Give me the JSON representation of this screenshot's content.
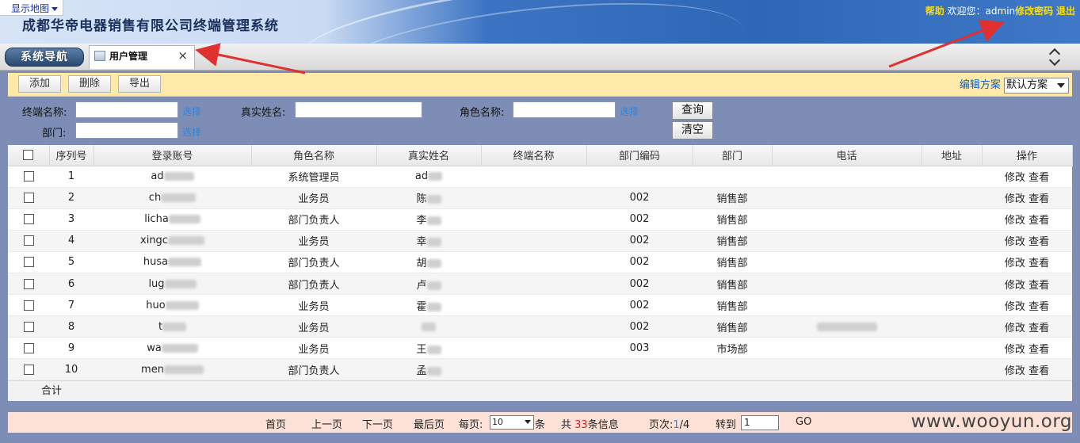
{
  "header": {
    "map_toggle": "显示地图",
    "system_title": "成都华帝电器销售有限公司终端管理系统",
    "help": "帮助",
    "welcome": "欢迎您：admin",
    "change_password": "修改密码",
    "logout": "退出"
  },
  "tabs": {
    "nav_button": "系统导航",
    "active_tab": "用户管理",
    "close_glyph": "×"
  },
  "toolbar": {
    "add": "添加",
    "delete": "删除",
    "export": "导出",
    "edit_plan": "编辑方案",
    "plan_value": "默认方案"
  },
  "filters": {
    "terminal_label": "终端名称:",
    "dept_label": "部门:",
    "real_name_label": "真实姓名:",
    "role_label": "角色名称:",
    "pick": "选择",
    "query": "查询",
    "clear": "清空"
  },
  "table": {
    "headers": [
      "序列号",
      "登录账号",
      "角色名称",
      "真实姓名",
      "终端名称",
      "部门编码",
      "部门",
      "电话",
      "地址",
      "操作"
    ],
    "rows": [
      {
        "seq": "1",
        "account": "ad",
        "role": "系统管理员",
        "name": "ad",
        "terminal": "",
        "dept_code": "",
        "dept": "",
        "phone": "",
        "address": ""
      },
      {
        "seq": "2",
        "account": "ch",
        "role": "业务员",
        "name": "陈",
        "terminal": "",
        "dept_code": "002",
        "dept": "销售部",
        "phone": "",
        "address": ""
      },
      {
        "seq": "3",
        "account": "licha",
        "role": "部门负责人",
        "name": "李",
        "terminal": "",
        "dept_code": "002",
        "dept": "销售部",
        "phone": "",
        "address": ""
      },
      {
        "seq": "4",
        "account": "xingc",
        "role": "业务员",
        "name": "幸",
        "terminal": "",
        "dept_code": "002",
        "dept": "销售部",
        "phone": "",
        "address": ""
      },
      {
        "seq": "5",
        "account": "husa",
        "role": "部门负责人",
        "name": "胡",
        "terminal": "",
        "dept_code": "002",
        "dept": "销售部",
        "phone": "",
        "address": ""
      },
      {
        "seq": "6",
        "account": "lug",
        "role": "部门负责人",
        "name": "卢",
        "terminal": "",
        "dept_code": "002",
        "dept": "销售部",
        "phone": "",
        "address": ""
      },
      {
        "seq": "7",
        "account": "huo",
        "role": "业务员",
        "name": "霍",
        "terminal": "",
        "dept_code": "002",
        "dept": "销售部",
        "phone": "",
        "address": ""
      },
      {
        "seq": "8",
        "account": "t",
        "role": "业务员",
        "name": "",
        "terminal": "",
        "dept_code": "002",
        "dept": "销售部",
        "phone": "",
        "address": ""
      },
      {
        "seq": "9",
        "account": "wa",
        "role": "业务员",
        "name": "王",
        "terminal": "",
        "dept_code": "003",
        "dept": "市场部",
        "phone": "",
        "address": ""
      },
      {
        "seq": "10",
        "account": "men",
        "role": "部门负责人",
        "name": "孟",
        "terminal": "",
        "dept_code": "",
        "dept": "",
        "phone": "",
        "address": ""
      }
    ],
    "op_edit": "修改",
    "op_view": "查看",
    "total_label": "合计"
  },
  "pager": {
    "first": "首页",
    "prev": "上一页",
    "next": "下一页",
    "last": "最后页",
    "per_page_label": "每页:",
    "per_page_value": "10",
    "per_page_unit": "条",
    "total_prefix": "共",
    "total_count": "33",
    "total_suffix": "条信息",
    "page_label": "页次:",
    "page_current": "1",
    "page_total": "/4",
    "goto_label": "转到",
    "goto_value": "1",
    "go": "GO"
  },
  "watermark": "www.wooyun.org",
  "colors": {
    "content_bg": "#7d8db5",
    "toolbar_bg": "#fde9a8",
    "pager_bg": "#fde0d6",
    "link_blue": "#2a86e0",
    "header_yellow": "#ffde00",
    "arrow_red": "#e03030"
  }
}
